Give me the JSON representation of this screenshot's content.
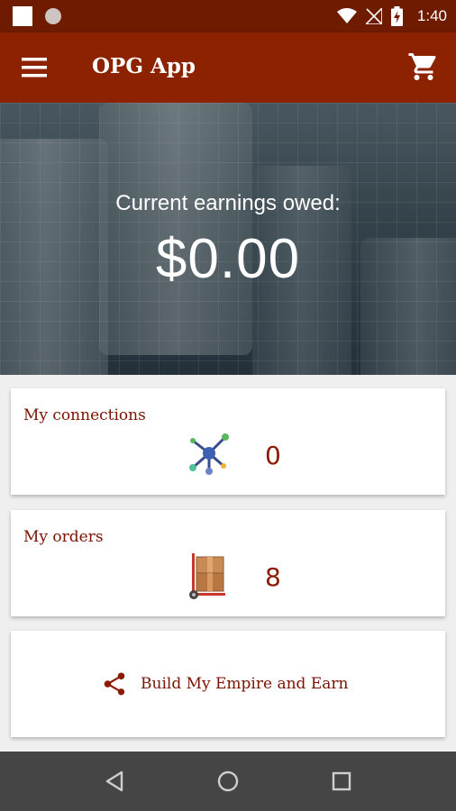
{
  "status_bar": {
    "time": "1:40",
    "icons": [
      "notification-square-icon",
      "notification-circle-icon",
      "wifi-icon",
      "no-signal-icon",
      "battery-charging-icon"
    ]
  },
  "app_bar": {
    "title": "OPG App",
    "menu_icon": "hamburger-menu-icon",
    "cart_icon": "shopping-cart-icon"
  },
  "hero": {
    "label": "Current earnings owed:",
    "value": "$0.00"
  },
  "cards": {
    "connections": {
      "title": "My connections",
      "count": "0",
      "icon": "network-nodes-icon"
    },
    "orders": {
      "title": "My orders",
      "count": "8",
      "icon": "hand-truck-boxes-icon"
    },
    "empire": {
      "label": "Build My Empire and Earn",
      "icon": "share-icon"
    }
  },
  "nav_bar": {
    "icons": [
      "back-triangle-icon",
      "home-circle-icon",
      "recents-square-icon"
    ]
  },
  "colors": {
    "app_bar": "#8c2200",
    "status_bar": "#6e1b00",
    "accent_text": "#7a1300",
    "nav_bar": "#454545"
  }
}
